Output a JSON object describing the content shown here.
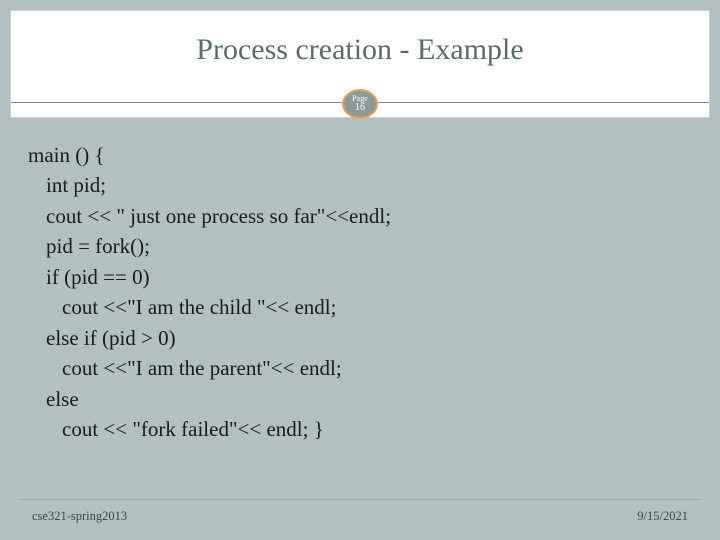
{
  "slide": {
    "title": "Process creation - Example",
    "page_label": "Page",
    "page_number": "16",
    "code": {
      "l1": "main () {",
      "l2": "int pid;",
      "l3": "cout << \" just one process so far\"<<endl;",
      "l4": "pid = fork();",
      "l5": "if (pid == 0)",
      "l6": "cout <<\"I am the child \"<< endl;",
      "l7": "else if (pid > 0)",
      "l8": "cout <<\"I am the parent\"<< endl;",
      "l9": "else",
      "l10": "cout << \"fork failed\"<< endl; }"
    },
    "footer_left": "cse321-spring2013",
    "footer_right": "9/15/2021"
  }
}
